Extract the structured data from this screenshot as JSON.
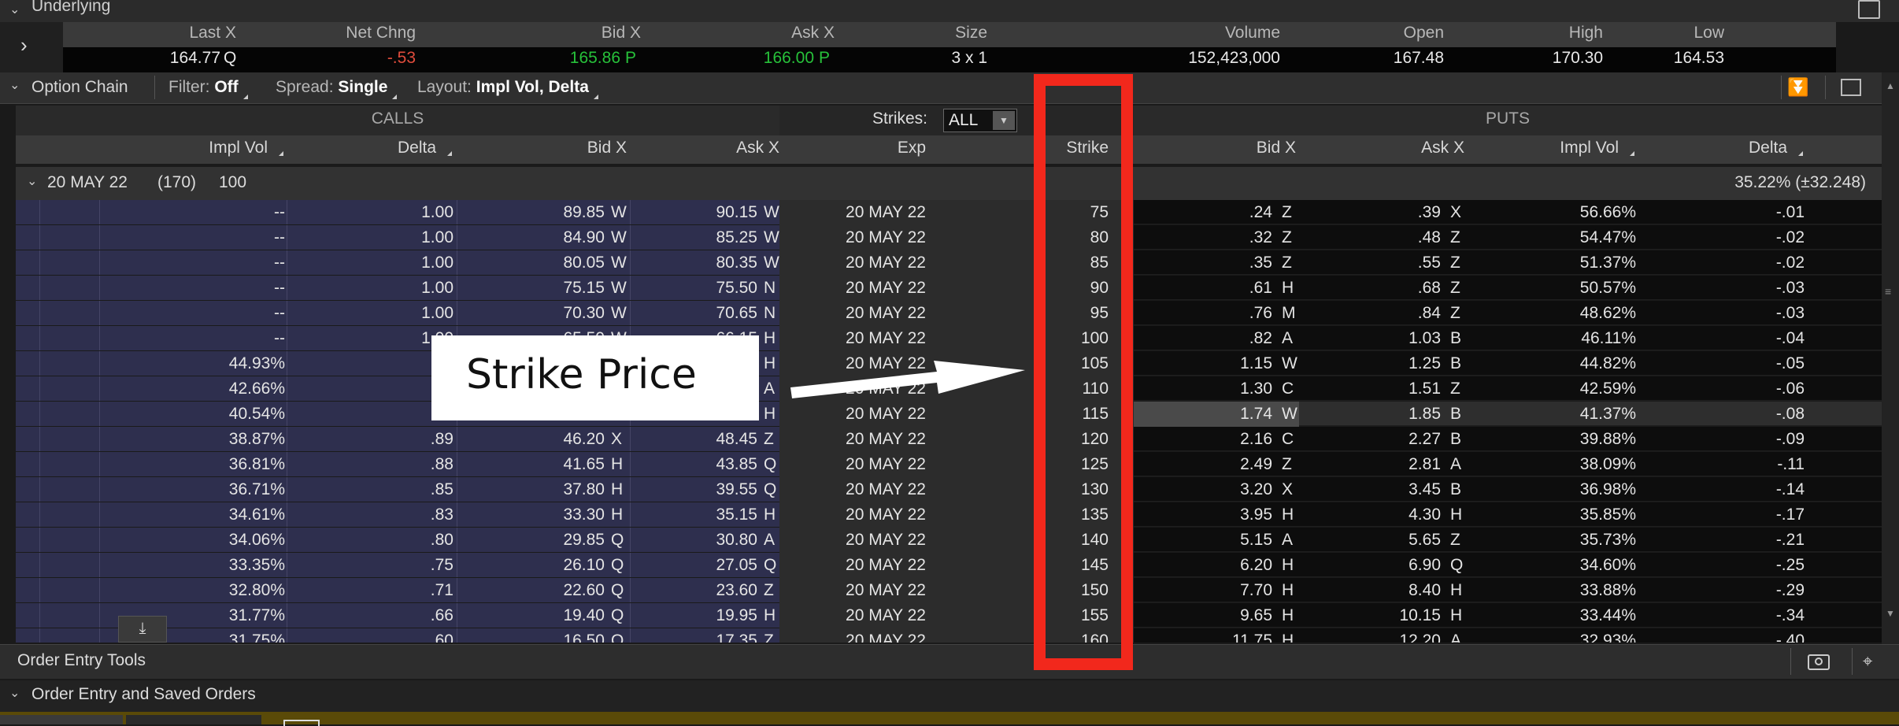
{
  "underlying": {
    "section_label": "Underlying",
    "columns": [
      "Last X",
      "Net Chng",
      "Bid X",
      "Ask X",
      "Size",
      "Volume",
      "Open",
      "High",
      "Low"
    ],
    "last": "164.77",
    "last_ex": "Q",
    "net_chng": "-.53",
    "bid": "165.86",
    "bid_ex": "P",
    "ask": "166.00",
    "ask_ex": "P",
    "size": "3 x 1",
    "volume": "152,423,000",
    "open": "167.48",
    "high": "170.30",
    "low": "164.53",
    "colors": {
      "negative": "#e04c3c",
      "up": "#27c13a"
    }
  },
  "option_chain": {
    "title": "Option Chain",
    "filter_label": "Filter:",
    "filter_value": "Off",
    "spread_label": "Spread:",
    "spread_value": "Single",
    "layout_label": "Layout:",
    "layout_value": "Impl Vol, Delta",
    "calls_label": "CALLS",
    "puts_label": "PUTS",
    "strikes_label": "Strikes:",
    "strikes_value": "ALL",
    "call_columns": [
      "Impl Vol",
      "Delta",
      "Bid X",
      "Ask X"
    ],
    "mid_columns": [
      "Exp",
      "Strike"
    ],
    "put_columns": [
      "Bid X",
      "Ask X",
      "Impl Vol",
      "Delta"
    ],
    "expiration": {
      "label": "20 MAY 22",
      "days": "(170)",
      "multiplier": "100",
      "iv": "35.22% (±32.248)"
    },
    "rows": [
      {
        "civ": "--",
        "cd": "1.00",
        "cb": "89.85",
        "cbx": "W",
        "ca": "90.15",
        "cax": "W",
        "exp": "20 MAY 22",
        "k": "75",
        "pb": ".24",
        "pbx": "Z",
        "pa": ".39",
        "pax": "X",
        "piv": "56.66%",
        "pd": "-.01"
      },
      {
        "civ": "--",
        "cd": "1.00",
        "cb": "84.90",
        "cbx": "W",
        "ca": "85.25",
        "cax": "W",
        "exp": "20 MAY 22",
        "k": "80",
        "pb": ".32",
        "pbx": "Z",
        "pa": ".48",
        "pax": "Z",
        "piv": "54.47%",
        "pd": "-.02"
      },
      {
        "civ": "--",
        "cd": "1.00",
        "cb": "80.05",
        "cbx": "W",
        "ca": "80.35",
        "cax": "W",
        "exp": "20 MAY 22",
        "k": "85",
        "pb": ".35",
        "pbx": "Z",
        "pa": ".55",
        "pax": "Z",
        "piv": "51.37%",
        "pd": "-.02"
      },
      {
        "civ": "--",
        "cd": "1.00",
        "cb": "75.15",
        "cbx": "W",
        "ca": "75.50",
        "cax": "N",
        "exp": "20 MAY 22",
        "k": "90",
        "pb": ".61",
        "pbx": "H",
        "pa": ".68",
        "pax": "Z",
        "piv": "50.57%",
        "pd": "-.03"
      },
      {
        "civ": "--",
        "cd": "1.00",
        "cb": "70.30",
        "cbx": "W",
        "ca": "70.65",
        "cax": "N",
        "exp": "20 MAY 22",
        "k": "95",
        "pb": ".76",
        "pbx": "M",
        "pa": ".84",
        "pax": "Z",
        "piv": "48.62%",
        "pd": "-.03"
      },
      {
        "civ": "--",
        "cd": "1.00",
        "cb": "65.50",
        "cbx": "W",
        "ca": "66.15",
        "cax": "H",
        "exp": "20 MAY 22",
        "k": "100",
        "pb": ".82",
        "pbx": "A",
        "pa": "1.03",
        "pax": "B",
        "piv": "46.11%",
        "pd": "-.04"
      },
      {
        "civ": "44.93%",
        "cd": ".91",
        "cb": "",
        "cbx": "",
        "ca": "",
        "cax": "H",
        "exp": "20 MAY 22",
        "k": "105",
        "pb": "1.15",
        "pbx": "W",
        "pa": "1.25",
        "pax": "B",
        "piv": "44.82%",
        "pd": "-.05"
      },
      {
        "civ": "42.66%",
        "cd": ".91",
        "cb": "",
        "cbx": "",
        "ca": "",
        "cax": "A",
        "exp": "20 MAY 22",
        "k": "110",
        "pb": "1.30",
        "pbx": "C",
        "pa": "1.51",
        "pax": "Z",
        "piv": "42.59%",
        "pd": "-.06"
      },
      {
        "civ": "40.54%",
        "cd": ".90",
        "cb": "",
        "cbx": "",
        "ca": "",
        "cax": "H",
        "exp": "20 MAY 22",
        "k": "115",
        "pb": "1.74",
        "pbx": "W",
        "pa": "1.85",
        "pax": "B",
        "piv": "41.37%",
        "pd": "-.08",
        "highlight": true
      },
      {
        "civ": "38.87%",
        "cd": ".89",
        "cb": "46.20",
        "cbx": "X",
        "ca": "48.45",
        "cax": "Z",
        "exp": "20 MAY 22",
        "k": "120",
        "pb": "2.16",
        "pbx": "C",
        "pa": "2.27",
        "pax": "B",
        "piv": "39.88%",
        "pd": "-.09"
      },
      {
        "civ": "36.81%",
        "cd": ".88",
        "cb": "41.65",
        "cbx": "H",
        "ca": "43.85",
        "cax": "Q",
        "exp": "20 MAY 22",
        "k": "125",
        "pb": "2.49",
        "pbx": "Z",
        "pa": "2.81",
        "pax": "A",
        "piv": "38.09%",
        "pd": "-.11"
      },
      {
        "civ": "36.71%",
        "cd": ".85",
        "cb": "37.80",
        "cbx": "H",
        "ca": "39.55",
        "cax": "Q",
        "exp": "20 MAY 22",
        "k": "130",
        "pb": "3.20",
        "pbx": "X",
        "pa": "3.45",
        "pax": "B",
        "piv": "36.98%",
        "pd": "-.14"
      },
      {
        "civ": "34.61%",
        "cd": ".83",
        "cb": "33.30",
        "cbx": "H",
        "ca": "35.15",
        "cax": "H",
        "exp": "20 MAY 22",
        "k": "135",
        "pb": "3.95",
        "pbx": "H",
        "pa": "4.30",
        "pax": "H",
        "piv": "35.85%",
        "pd": "-.17"
      },
      {
        "civ": "34.06%",
        "cd": ".80",
        "cb": "29.85",
        "cbx": "Q",
        "ca": "30.80",
        "cax": "A",
        "exp": "20 MAY 22",
        "k": "140",
        "pb": "5.15",
        "pbx": "A",
        "pa": "5.65",
        "pax": "Z",
        "piv": "35.73%",
        "pd": "-.21"
      },
      {
        "civ": "33.35%",
        "cd": ".75",
        "cb": "26.10",
        "cbx": "Q",
        "ca": "27.05",
        "cax": "Q",
        "exp": "20 MAY 22",
        "k": "145",
        "pb": "6.20",
        "pbx": "H",
        "pa": "6.90",
        "pax": "Q",
        "piv": "34.60%",
        "pd": "-.25"
      },
      {
        "civ": "32.80%",
        "cd": ".71",
        "cb": "22.60",
        "cbx": "Q",
        "ca": "23.60",
        "cax": "Z",
        "exp": "20 MAY 22",
        "k": "150",
        "pb": "7.70",
        "pbx": "H",
        "pa": "8.40",
        "pax": "H",
        "piv": "33.88%",
        "pd": "-.29"
      },
      {
        "civ": "31.77%",
        "cd": ".66",
        "cb": "19.40",
        "cbx": "Q",
        "ca": "19.95",
        "cax": "H",
        "exp": "20 MAY 22",
        "k": "155",
        "pb": "9.65",
        "pbx": "H",
        "pa": "10.15",
        "pax": "H",
        "piv": "33.44%",
        "pd": "-.34"
      },
      {
        "civ": "31.75%",
        "cd": ".60",
        "cb": "16.50",
        "cbx": "Q",
        "ca": "17.35",
        "cax": "Z",
        "exp": "20 MAY 22",
        "k": "160",
        "pb": "11.75",
        "pbx": "H",
        "pa": "12.20",
        "pax": "A",
        "piv": "32.93%",
        "pd": "-.40"
      }
    ]
  },
  "bottom": {
    "order_entry_tools": "Order Entry Tools",
    "order_entry_saved": "Order Entry and Saved Orders"
  },
  "annotation": {
    "label": "Strike Price",
    "box_color": "#f2281c"
  }
}
